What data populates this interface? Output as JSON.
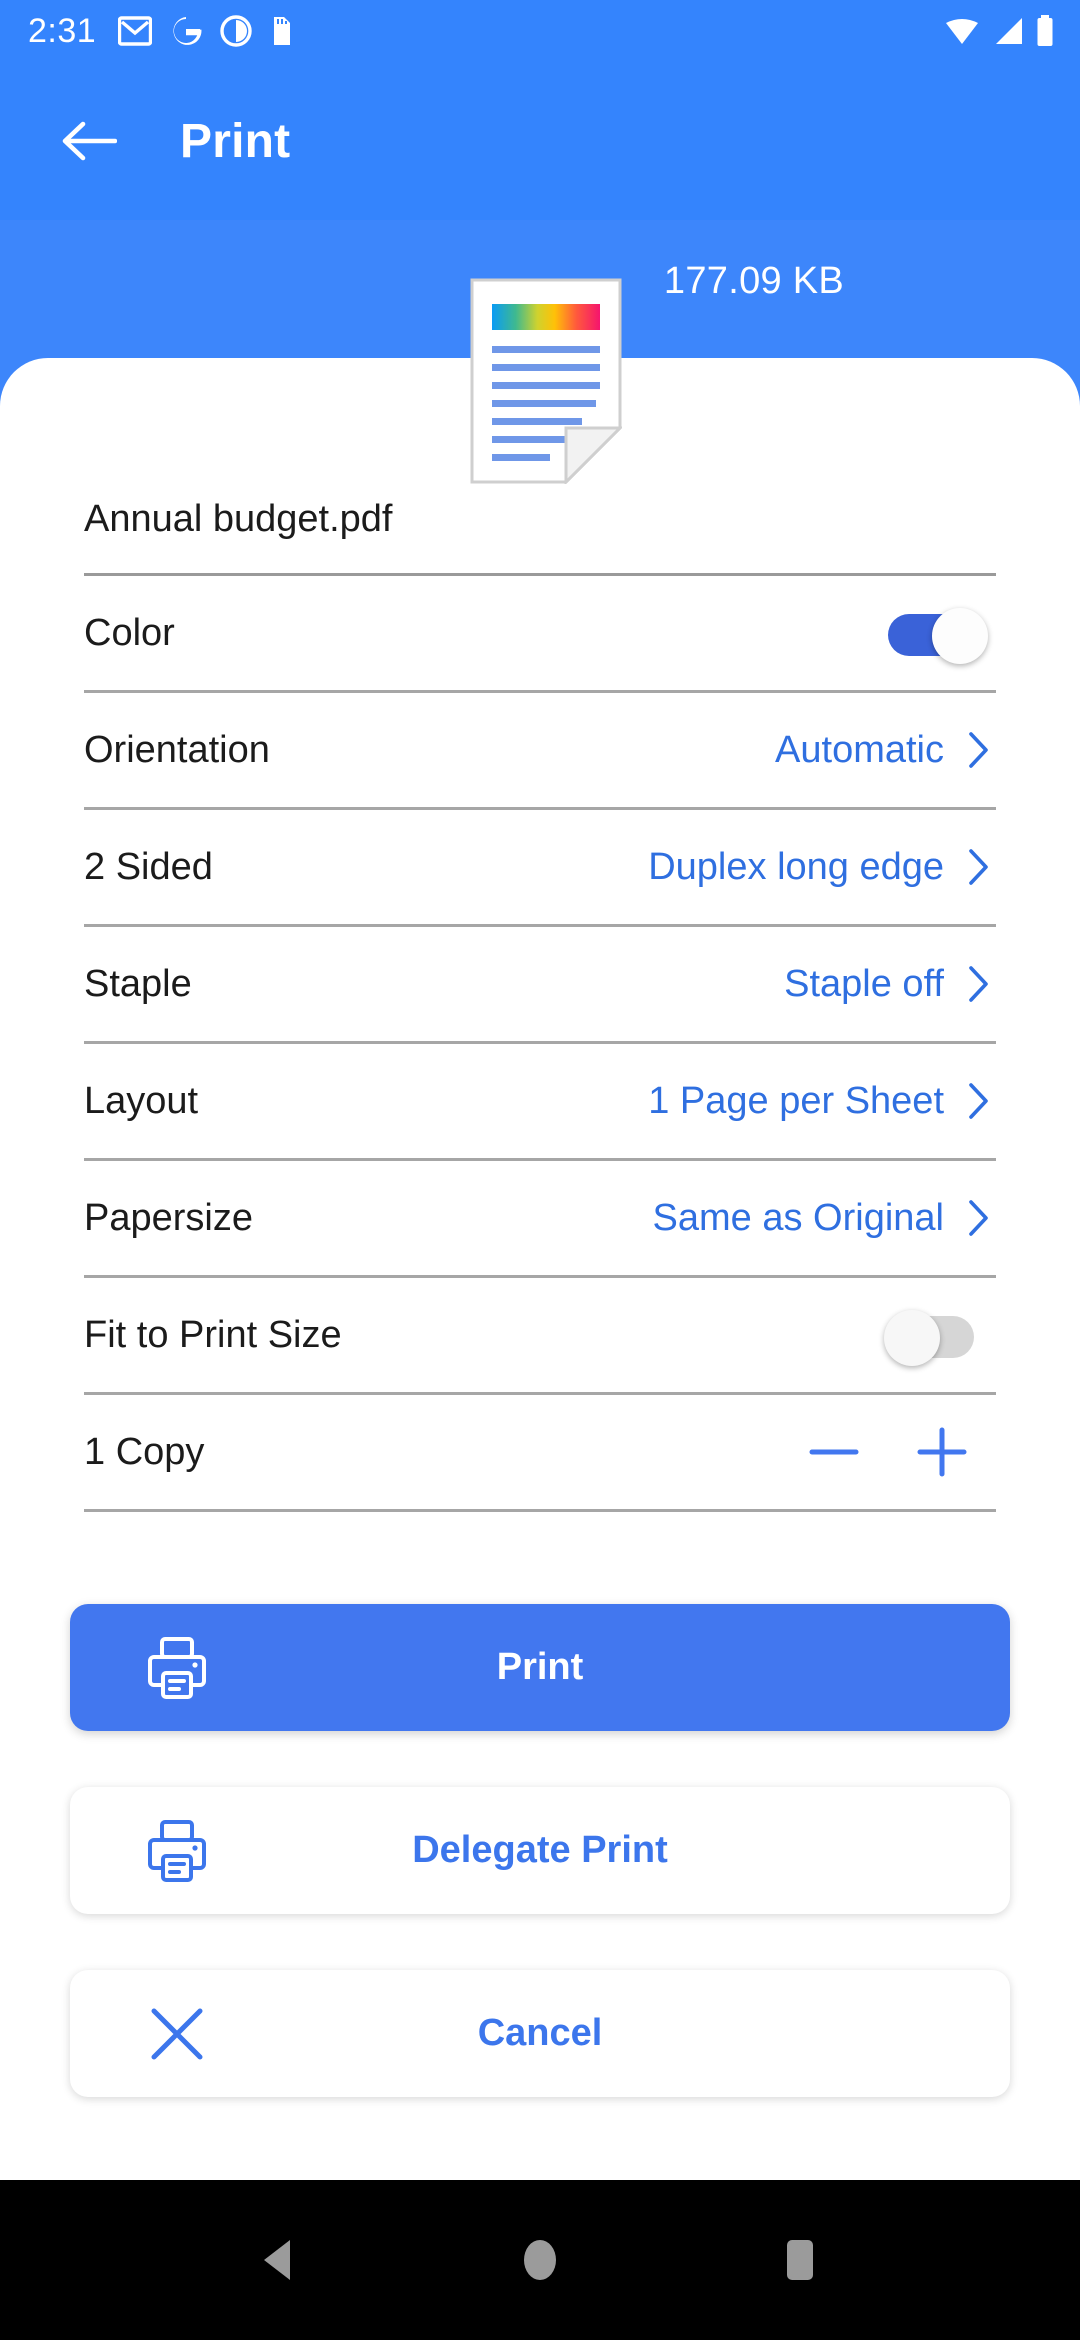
{
  "statusbar": {
    "time": "2:31",
    "left_icons": [
      "gmail-icon",
      "google-icon",
      "app-icon",
      "sd-card-icon"
    ],
    "right_icons": [
      "wifi-icon",
      "signal-icon",
      "battery-icon"
    ]
  },
  "appbar": {
    "back_icon": "back-arrow-icon",
    "title": "Print"
  },
  "preview": {
    "file_size": "177.09 KB",
    "thumbnail_icon": "document-thumbnail-icon"
  },
  "filename": {
    "value": "Annual budget.pdf"
  },
  "options": [
    {
      "label": "Color",
      "type": "toggle",
      "state": "on"
    },
    {
      "label": "Orientation",
      "type": "value",
      "value": "Automatic"
    },
    {
      "label": "2 Sided",
      "type": "value",
      "value": "Duplex long edge"
    },
    {
      "label": "Staple",
      "type": "value",
      "value": "Staple off"
    },
    {
      "label": "Layout",
      "type": "value",
      "value": "1 Page per Sheet"
    },
    {
      "label": "Papersize",
      "type": "value",
      "value": "Same as Original"
    },
    {
      "label": "Fit to Print Size",
      "type": "toggle",
      "state": "off"
    }
  ],
  "copies": {
    "label": "1  Copy",
    "count": 1,
    "decrement_icon": "minus-icon",
    "increment_icon": "plus-icon"
  },
  "actions": {
    "print": {
      "label": "Print",
      "icon": "printer-icon"
    },
    "delegate": {
      "label": "Delegate Print",
      "icon": "printer-icon"
    },
    "cancel": {
      "label": "Cancel",
      "icon": "close-icon"
    }
  },
  "navbar": {
    "back": "nav-back-icon",
    "home": "nav-home-icon",
    "recents": "nav-recents-icon"
  },
  "colors": {
    "header_blue": "#3484fd",
    "preview_blue": "#3d86fb",
    "accent_blue": "#2f6fe0",
    "primary_button": "#4277ef",
    "toggle_on": "#3a62d8",
    "toggle_off": "#d6d6d6",
    "divider": "#a6a6a6",
    "navbar_bg": "#000000"
  }
}
